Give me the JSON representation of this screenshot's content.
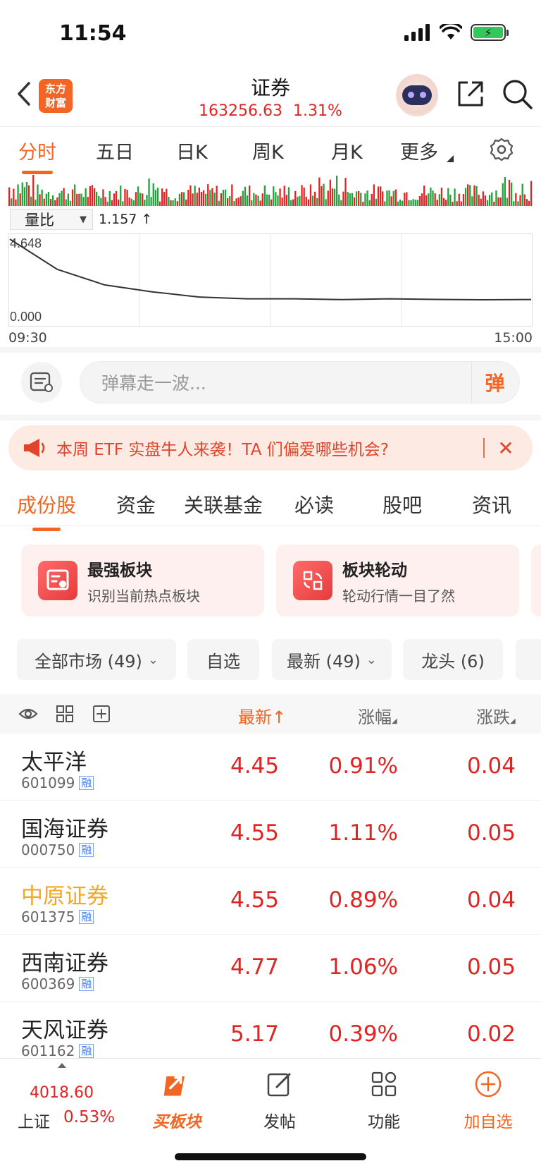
{
  "status_bar": {
    "time": "11:54"
  },
  "header": {
    "logo_line1": "东方",
    "logo_line2": "财富",
    "title": "证券",
    "index_value": "163256.63",
    "index_change_pct": "1.31%"
  },
  "chart_tabs": [
    "分时",
    "五日",
    "日K",
    "周K",
    "月K",
    "更多"
  ],
  "volume_ratio": {
    "select_label": "量比",
    "current_value": "1.157 ↑",
    "y_max": "4.648",
    "y_min": "0.000",
    "time_start": "09:30",
    "time_end": "15:00"
  },
  "chart_data": [
    {
      "type": "bar",
      "title": "",
      "series": [
        {
          "name": "",
          "values": []
        }
      ],
      "note_colors": {
        "up": "#e02424",
        "down": "#22a33a"
      }
    },
    {
      "type": "line",
      "x": [
        "09:30",
        "09:35",
        "09:45",
        "10:00",
        "10:30",
        "11:00",
        "11:30",
        "13:00",
        "13:30",
        "14:00",
        "14:30",
        "15:00"
      ],
      "values": [
        4.648,
        2.9,
        2.0,
        1.6,
        1.3,
        1.2,
        1.2,
        1.15,
        1.2,
        1.16,
        1.14,
        1.157
      ],
      "ylim": [
        0,
        4.648
      ],
      "xlabel": "",
      "ylabel": ""
    }
  ],
  "danmu": {
    "placeholder": "弹幕走一波...",
    "send_label": "弹"
  },
  "promo": {
    "text": "本周 ETF 实盘牛人来袭！TA 们偏爱哪些机会?"
  },
  "section_tabs": [
    "成份股",
    "资金",
    "关联基金",
    "必读",
    "股吧",
    "资讯"
  ],
  "feature_cards": [
    {
      "title": "最强板块",
      "subtitle": "识别当前热点板块"
    },
    {
      "title": "板块轮动",
      "subtitle": "轮动行情一目了然"
    }
  ],
  "filters": [
    "全部市场 (49)",
    "自选",
    "最新 (49)",
    "龙头 (6)"
  ],
  "list_header": {
    "price": "最新",
    "pct": "涨幅",
    "chg": "涨跌"
  },
  "stocks": [
    {
      "name": "太平洋",
      "code": "601099",
      "badge": "融",
      "price": "4.45",
      "pct": "0.91%",
      "chg": "0.04",
      "name_color": "#222222"
    },
    {
      "name": "国海证券",
      "code": "000750",
      "badge": "融",
      "price": "4.55",
      "pct": "1.11%",
      "chg": "0.05",
      "name_color": "#222222"
    },
    {
      "name": "中原证券",
      "code": "601375",
      "badge": "融",
      "price": "4.55",
      "pct": "0.89%",
      "chg": "0.04",
      "name_color": "#f5a623"
    },
    {
      "name": "西南证券",
      "code": "600369",
      "badge": "融",
      "price": "4.77",
      "pct": "1.06%",
      "chg": "0.05",
      "name_color": "#222222"
    },
    {
      "name": "天风证券",
      "code": "601162",
      "badge": "融",
      "price": "5.17",
      "pct": "0.39%",
      "chg": "0.02",
      "name_color": "#222222"
    }
  ],
  "bottom_bar": {
    "index_value": "4018.60",
    "index_name": "上证",
    "index_pct": "0.53%",
    "items": [
      "买板块",
      "发帖",
      "功能",
      "加自选"
    ]
  },
  "colors": {
    "accent": "#f26522",
    "up": "#e02424",
    "down": "#22a33a"
  }
}
